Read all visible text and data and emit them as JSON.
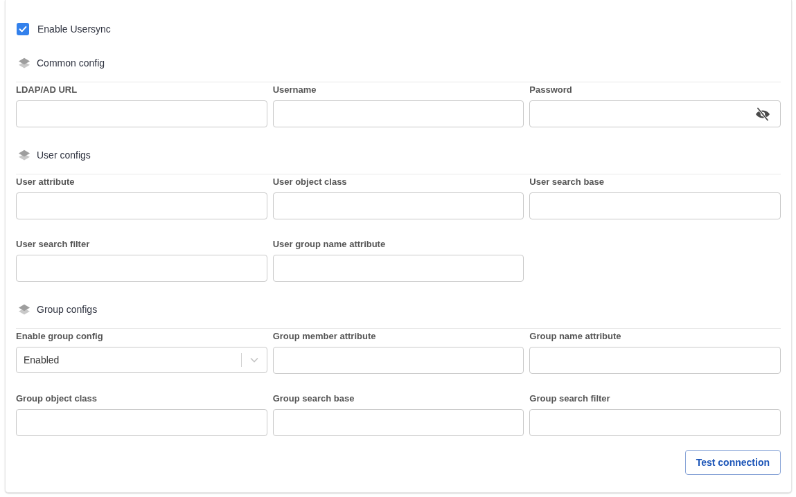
{
  "enable_usersync": {
    "label": "Enable Usersync",
    "checked": true
  },
  "sections": [
    {
      "title": "Common config",
      "fields": [
        {
          "kind": "text",
          "label": "LDAP/AD URL"
        },
        {
          "kind": "text",
          "label": "Username"
        },
        {
          "kind": "password",
          "label": "Password"
        }
      ]
    },
    {
      "title": "User configs",
      "fields": [
        {
          "kind": "text",
          "label": "User attribute"
        },
        {
          "kind": "text",
          "label": "User object class"
        },
        {
          "kind": "text",
          "label": "User search base"
        },
        {
          "kind": "text",
          "label": "User search filter"
        },
        {
          "kind": "text",
          "label": "User group name attribute"
        }
      ]
    },
    {
      "title": "Group configs",
      "fields": [
        {
          "kind": "select",
          "label": "Enable group config",
          "value": "Enabled"
        },
        {
          "kind": "text",
          "label": "Group member attribute"
        },
        {
          "kind": "text",
          "label": "Group name attribute"
        },
        {
          "kind": "text",
          "label": "Group object class"
        },
        {
          "kind": "text",
          "label": "Group search base"
        },
        {
          "kind": "text",
          "label": "Group search filter"
        }
      ]
    }
  ],
  "actions": [
    {
      "label": "Test connection"
    }
  ]
}
